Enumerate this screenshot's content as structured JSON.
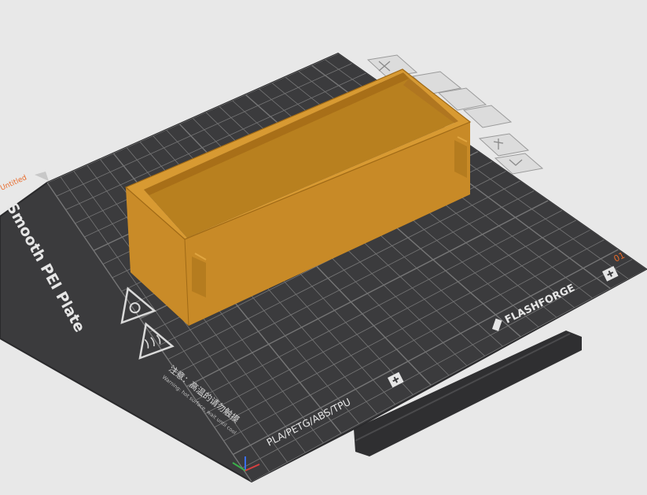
{
  "plate": {
    "name": "Smooth PEI Plate",
    "brand": "FLASHFORGE",
    "materials": "PLA/PETG/ABS/TPU",
    "warning_cn": "注意：高温的请勿触摸",
    "warning_en": "Warning: hot surface, wait until cool",
    "plate_index": "01",
    "left_label": "Untitled"
  },
  "colors": {
    "background": "#e8e8e8",
    "plate": "#3b3b3d",
    "grid": "#8a8a8a",
    "model_top": "#d4962e",
    "model_side": "#c88a27",
    "model_dark": "#a86f18",
    "index_color": "#e86a2a"
  },
  "icons": [
    "close-icon",
    "grid-icon",
    "layers-icon",
    "filament-icon",
    "settings-icon",
    "lock-icon"
  ]
}
